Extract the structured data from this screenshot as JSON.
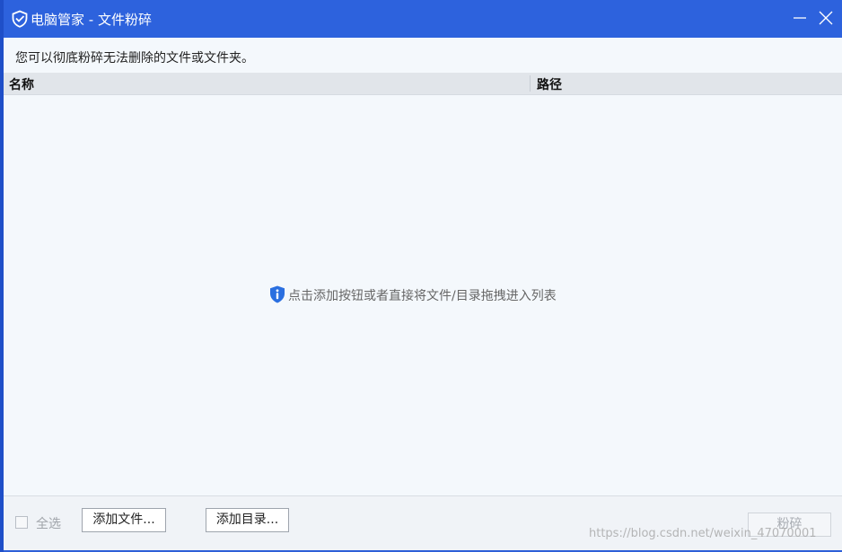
{
  "window": {
    "title": "电脑管家 - 文件粉碎",
    "accent_color": "#2d62dd",
    "logo_icon": "shield-check-icon",
    "minimize_icon": "minimize-icon",
    "close_icon": "close-icon"
  },
  "description": "您可以彻底粉碎无法删除的文件或文件夹。",
  "table": {
    "columns": [
      "名称",
      "路径"
    ],
    "rows": []
  },
  "empty_hint": {
    "icon": "info-shield-icon",
    "text": "点击添加按钮或者直接将文件/目录拖拽进入列表"
  },
  "footer": {
    "select_all_label": "全选",
    "select_all_checked": false,
    "add_file_label": "添加文件...",
    "add_dir_label": "添加目录...",
    "shred_label": "粉碎"
  },
  "watermark": "https://blog.csdn.net/weixin_47070001"
}
